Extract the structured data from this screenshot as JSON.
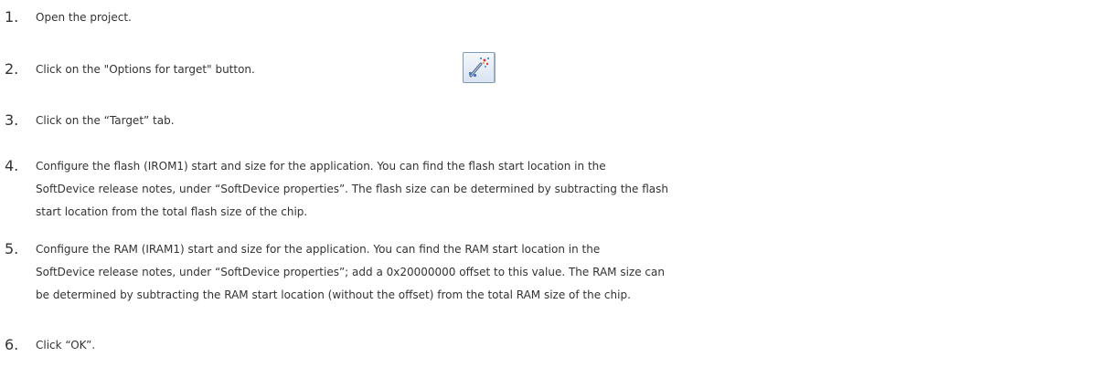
{
  "steps": [
    {
      "number": "1.",
      "lines": [
        "Open the project."
      ]
    },
    {
      "number": "2.",
      "lines": [
        "Click on the \"Options for target\" button."
      ],
      "icon": "options-for-target-icon"
    },
    {
      "number": "3.",
      "lines": [
        "Click on the “Target” tab."
      ]
    },
    {
      "number": "4.",
      "lines": [
        "Configure the flash (IROM1) start and size for the application. You can find the flash start location in the",
        "SoftDevice release notes, under “SoftDevice properties”. The flash size can be determined by subtracting the flash",
        "start location from the total flash size of the chip."
      ]
    },
    {
      "number": "5.",
      "lines": [
        "Configure the RAM (IRAM1) start and size for the application. You can find the RAM start location in the",
        "SoftDevice release notes, under “SoftDevice properties”; add a 0x20000000 offset to this value. The RAM size can",
        "be determined by subtracting the RAM start location (without the offset) from the total RAM size of the chip."
      ]
    },
    {
      "number": "6.",
      "lines": [
        "Click “OK”."
      ]
    }
  ]
}
